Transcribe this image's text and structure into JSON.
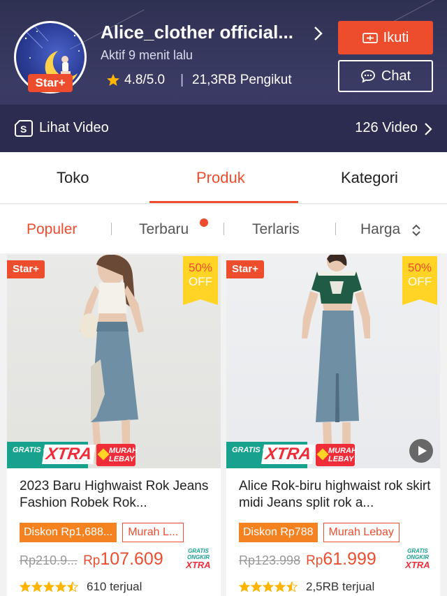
{
  "shop": {
    "name": "Alice_clother official...",
    "status": "Aktif 9 menit lalu",
    "badge": "Star+",
    "rating": "4.8/5.0",
    "followers": "21,3RB Pengikut",
    "follow_label": "Ikuti",
    "chat_label": "Chat",
    "video_label": "Lihat Video",
    "video_count": "126 Video"
  },
  "tabs": [
    {
      "label": "Toko",
      "active": false
    },
    {
      "label": "Produk",
      "active": true
    },
    {
      "label": "Kategori",
      "active": false
    }
  ],
  "sort": [
    {
      "label": "Populer",
      "active": true
    },
    {
      "label": "Terbaru",
      "active": false,
      "dot": true
    },
    {
      "label": "Terlaris",
      "active": false
    },
    {
      "label": "Harga",
      "active": false
    }
  ],
  "products": [
    {
      "badge": "Star+",
      "discount_pct": "50%",
      "discount_off": "OFF",
      "promo_gratis": "GRATIS ONGKIR",
      "promo_xtra": "XTRA",
      "promo_murah": "MURAH LEBAY",
      "title": "2023 Baru Highwaist Rok Jeans Fashion Robek Rok...",
      "tag_diskon": "Diskon Rp1,688...",
      "tag_murah": "Murah L...",
      "old_price": "Rp210.9...",
      "currency": "Rp",
      "price": "107.609",
      "mini_top": "GRATIS ONGKIR",
      "mini_xtra": "XTRA",
      "rating": 4.5,
      "sold": "610 terjual",
      "has_video": false
    },
    {
      "badge": "Star+",
      "discount_pct": "50%",
      "discount_off": "OFF",
      "promo_gratis": "GRATIS ONGKIR",
      "promo_xtra": "XTRA",
      "promo_murah": "MURAH LEBAY",
      "title": "Alice Rok-biru highwaist rok skirt midi Jeans split rok a...",
      "tag_diskon": "Diskon Rp788",
      "tag_murah": "Murah Lebay",
      "old_price": "Rp123.998",
      "currency": "Rp",
      "price": "61.999",
      "mini_top": "GRATIS ONGKIR",
      "mini_xtra": "XTRA",
      "rating": 4.5,
      "sold": "2,5RB terjual",
      "has_video": true
    }
  ],
  "colors": {
    "accent": "#ee4d2d",
    "header_bg": "#35365e",
    "promo_green": "#17a28e",
    "discount_yellow": "#ffd424",
    "diskon_orange": "#f58220"
  }
}
